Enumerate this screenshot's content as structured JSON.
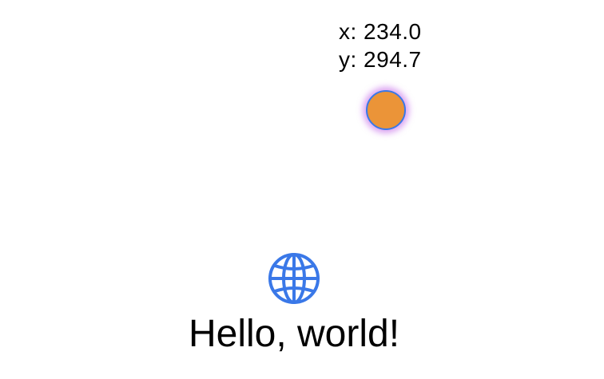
{
  "coordinates": {
    "x_text": "x: 234.0",
    "y_text": "y: 294.7"
  },
  "drag_dot": {
    "fill_color": "#EB9438",
    "border_color": "#3A78E8",
    "glow_color": "#BE5AE6"
  },
  "content": {
    "icon": "globe-icon",
    "icon_color": "#3A78E8",
    "greeting": "Hello, world!"
  }
}
